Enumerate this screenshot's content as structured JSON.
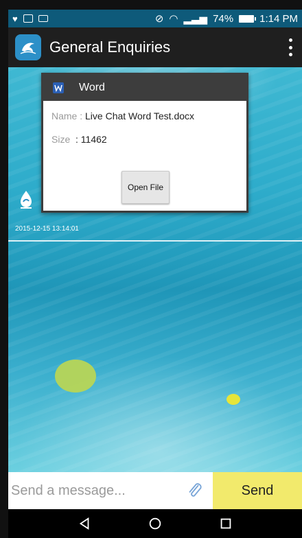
{
  "status_bar": {
    "battery": "74%",
    "time": "1:14 PM"
  },
  "app_bar": {
    "title": "General Enquiries"
  },
  "message_card": {
    "header": "Word",
    "name_label": "Name :",
    "name_value": "Live Chat Word Test.docx",
    "size_label": "Size",
    "size_value": ": 11462",
    "button": "Open File"
  },
  "timestamp": "2015-12-15 13:14:01",
  "composer": {
    "placeholder": "Send a message...",
    "send_label": "Send"
  },
  "colors": {
    "send_bg": "#f2ea6c",
    "app_bar_bg": "#1f1f1f",
    "status_bar_bg": "#0e5a7a",
    "card_header_bg": "#3d3d3d"
  },
  "icons": {
    "status_left": [
      "heart-icon",
      "gallery-icon",
      "mail-icon"
    ],
    "status_right": [
      "mute-icon",
      "wifi-icon",
      "signal-icon",
      "battery-icon"
    ],
    "nav": [
      "back-icon",
      "home-icon",
      "recents-icon"
    ]
  }
}
